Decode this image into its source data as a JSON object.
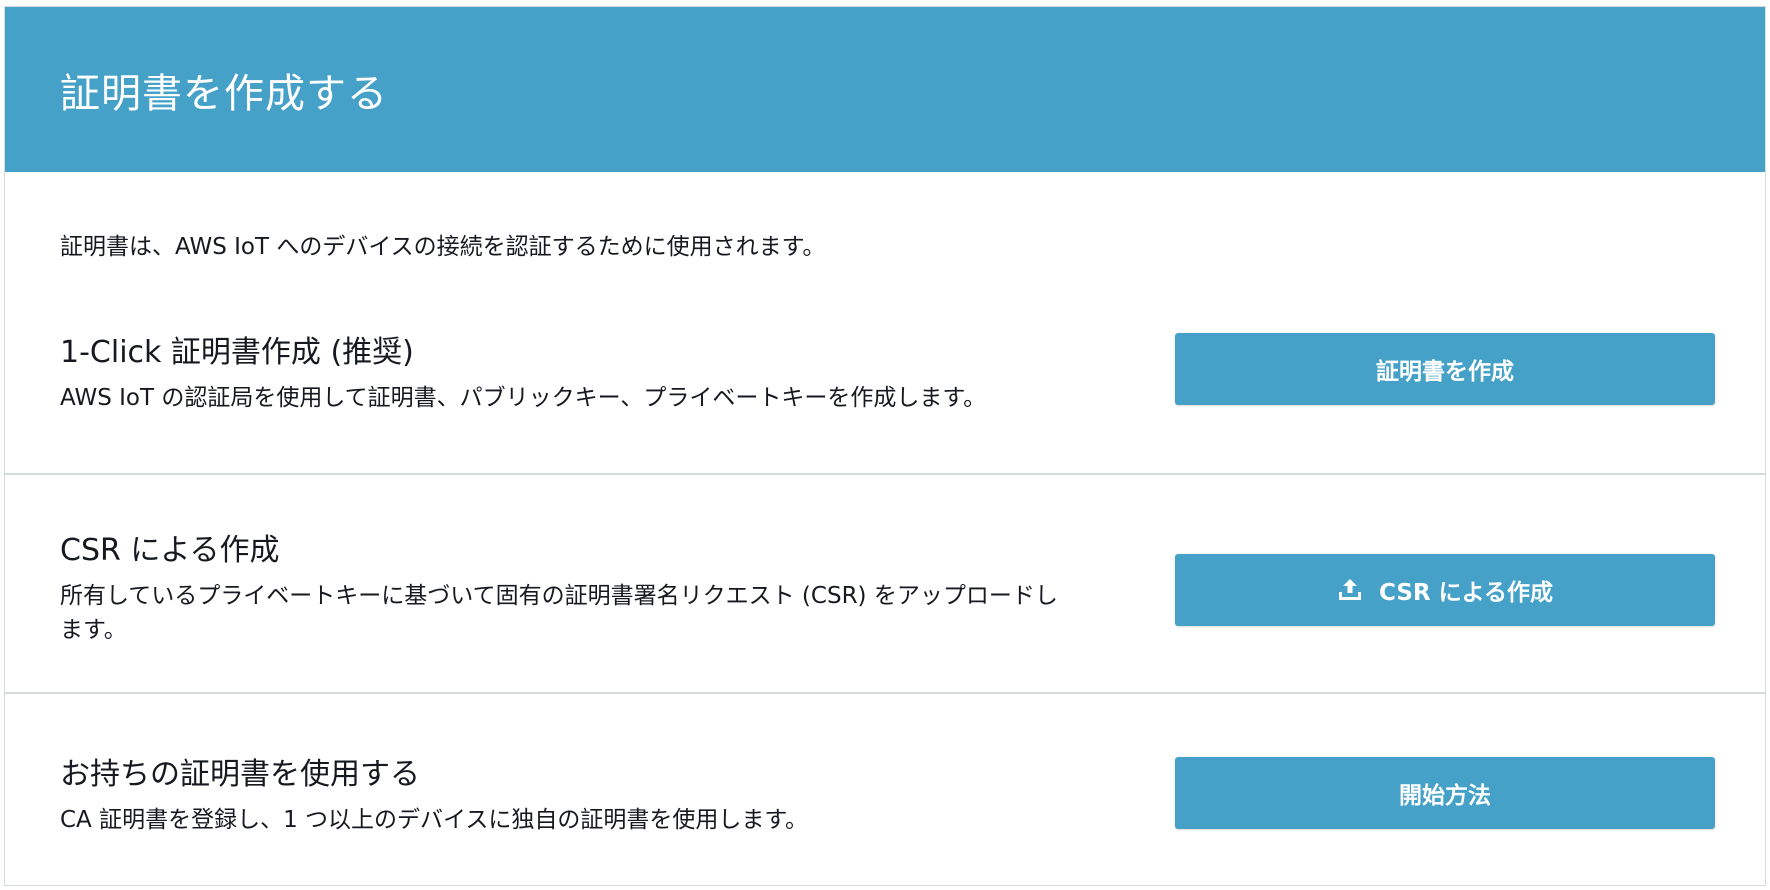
{
  "header": {
    "title": "証明書を作成する"
  },
  "intro": "証明書は、AWS IoT へのデバイスの接続を認証するために使用されます。",
  "options": [
    {
      "title": "1-Click 証明書作成 (推奨)",
      "description": "AWS IoT の認証局を使用して証明書、パブリックキー、プライベートキーを作成します。",
      "button_label": "証明書を作成"
    },
    {
      "title": "CSR による作成",
      "description": "所有しているプライベートキーに基づいて固有の証明書署名リクエスト (CSR) をアップロードします。",
      "button_label": "CSR による作成",
      "button_icon": "upload-icon"
    },
    {
      "title": "お持ちの証明書を使用する",
      "description": "CA 証明書を登録し、1 つ以上のデバイスに独自の証明書を使用します。",
      "button_label": "開始方法"
    }
  ],
  "colors": {
    "header_bg": "#46a1c8",
    "button_bg": "#46a1c8",
    "divider": "#d5dbdb",
    "text": "#16191f"
  }
}
